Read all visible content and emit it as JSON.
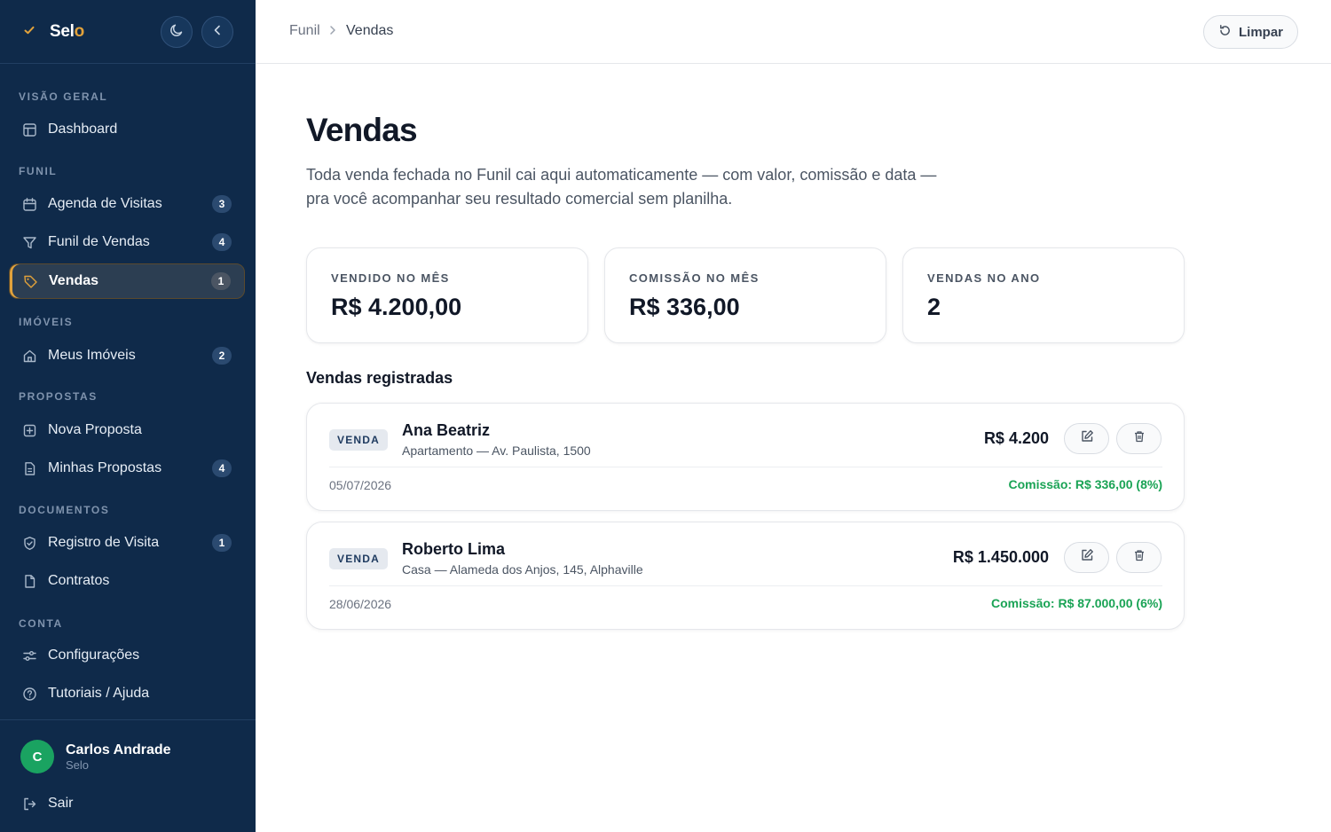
{
  "sidebar": {
    "brand": {
      "prefix": "Sel",
      "accent_letter": "o"
    },
    "sections": {
      "overview": "VISÃO GERAL",
      "funnel": "FUNIL",
      "properties": "IMÓVEIS",
      "proposals": "PROPOSTAS",
      "documents": "DOCUMENTOS",
      "account": "CONTA"
    },
    "items": {
      "dashboard": {
        "label": "Dashboard"
      },
      "agenda": {
        "label": "Agenda de Visitas",
        "badge": "3"
      },
      "funil": {
        "label": "Funil de Vendas",
        "badge": "4"
      },
      "vendas": {
        "label": "Vendas",
        "badge": "1"
      },
      "imoveis": {
        "label": "Meus Imóveis",
        "badge": "2"
      },
      "nova_proposta": {
        "label": "Nova Proposta"
      },
      "minhas_propostas": {
        "label": "Minhas Propostas",
        "badge": "4"
      },
      "registro": {
        "label": "Registro de Visita",
        "badge": "1"
      },
      "contratos": {
        "label": "Contratos"
      },
      "config": {
        "label": "Configurações"
      },
      "ajuda": {
        "label": "Tutoriais / Ajuda"
      },
      "sair": {
        "label": "Sair"
      }
    },
    "user": {
      "initial": "C",
      "name": "Carlos Andrade",
      "org": "Selo"
    }
  },
  "topbar": {
    "breadcrumb": [
      "Funil",
      "Vendas"
    ],
    "clear_label": "Limpar"
  },
  "main": {
    "title": "Vendas",
    "description_line1": "Toda venda fechada no Funil cai aqui automaticamente — com valor, comissão e data —",
    "description_line2": "pra você acompanhar seu resultado comercial sem planilha.",
    "stats": [
      {
        "label": "VENDIDO NO MÊS",
        "value": "R$ 4.200,00"
      },
      {
        "label": "COMISSÃO NO MÊS",
        "value": "R$ 336,00"
      },
      {
        "label": "VENDAS NO ANO",
        "value": "2"
      }
    ],
    "list_title": "Vendas registradas",
    "sales": [
      {
        "tag": "VENDA",
        "client": "Ana Beatriz",
        "property": "Apartamento — Av. Paulista, 1500",
        "amount": "R$ 4.200",
        "date": "05/07/2026",
        "commission": "Comissão: R$ 336,00 (8%)"
      },
      {
        "tag": "VENDA",
        "client": "Roberto Lima",
        "property": "Casa — Alameda dos Anjos, 145, Alphaville",
        "amount": "R$ 1.450.000",
        "date": "28/06/2026",
        "commission": "Comissão: R$ 87.000,00 (6%)"
      }
    ]
  },
  "colors": {
    "sidebar_bg": "#0f2a4a",
    "accent": "#e2a23b",
    "success": "#1aa355"
  }
}
